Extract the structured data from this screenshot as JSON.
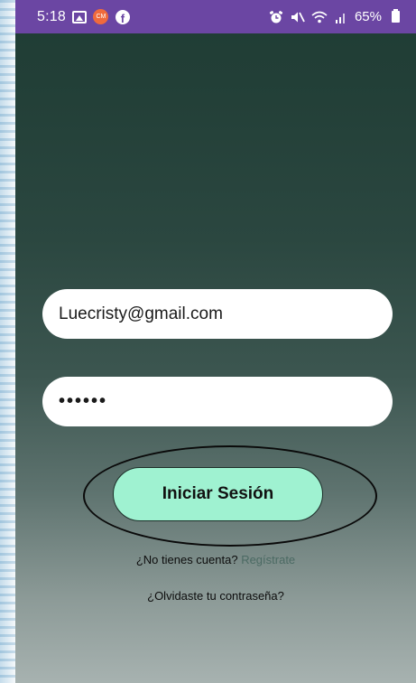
{
  "status_bar": {
    "time": "5:18",
    "battery": "65%",
    "left_icons": [
      "gallery-icon",
      "app-notification-icon",
      "facebook-icon"
    ],
    "right_icons": [
      "alarm-icon",
      "mute-icon",
      "wifi-icon",
      "signal-icon",
      "battery-icon"
    ]
  },
  "login_form": {
    "email_value": "Luecristy@gmail.com",
    "password_value": "••••••",
    "login_label": "Iniciar Sesión",
    "no_account_text": "¿No tienes cuenta?",
    "register_label": "Regístrate",
    "forgot_label": "¿Olvidaste tu contraseña?"
  },
  "colors": {
    "status_bar": "#6b46a3",
    "login_button": "#9ff2d1",
    "background_top": "#1f3c35",
    "background_bottom": "#a7b2b0"
  }
}
